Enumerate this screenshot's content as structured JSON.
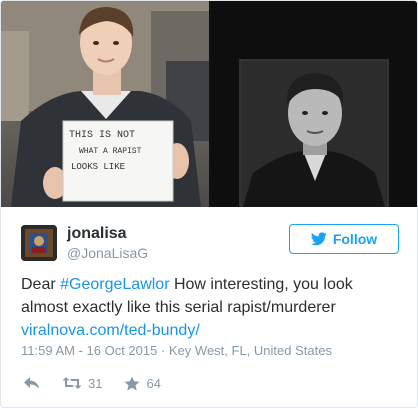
{
  "photo_sign": {
    "line1": "THIS IS NOT",
    "line2": "WHAT A RAPIST",
    "line3": "LOOKS LIKE"
  },
  "user": {
    "display_name": "jonalisa",
    "handle": "@JonaLisaG"
  },
  "follow_button": {
    "label": "Follow",
    "icon": "twitter-bird-icon"
  },
  "tweet": {
    "text_before": "Dear ",
    "hashtag": "#GeorgeLawlor",
    "text_after": " How interesting, you look almost exactly like this serial rapist/murderer",
    "link": "viralnova.com/ted-bundy/",
    "timestamp": "11:59 AM - 16 Oct 2015 · Key West, FL, United States"
  },
  "actions": {
    "reply_icon": "reply-icon",
    "retweet_icon": "retweet-icon",
    "retweet_count": "31",
    "like_icon": "star-icon",
    "like_count": "64"
  },
  "colors": {
    "accent": "#1da1f2",
    "link": "#1b95e0",
    "muted": "#8899a6",
    "text": "#292f33"
  }
}
